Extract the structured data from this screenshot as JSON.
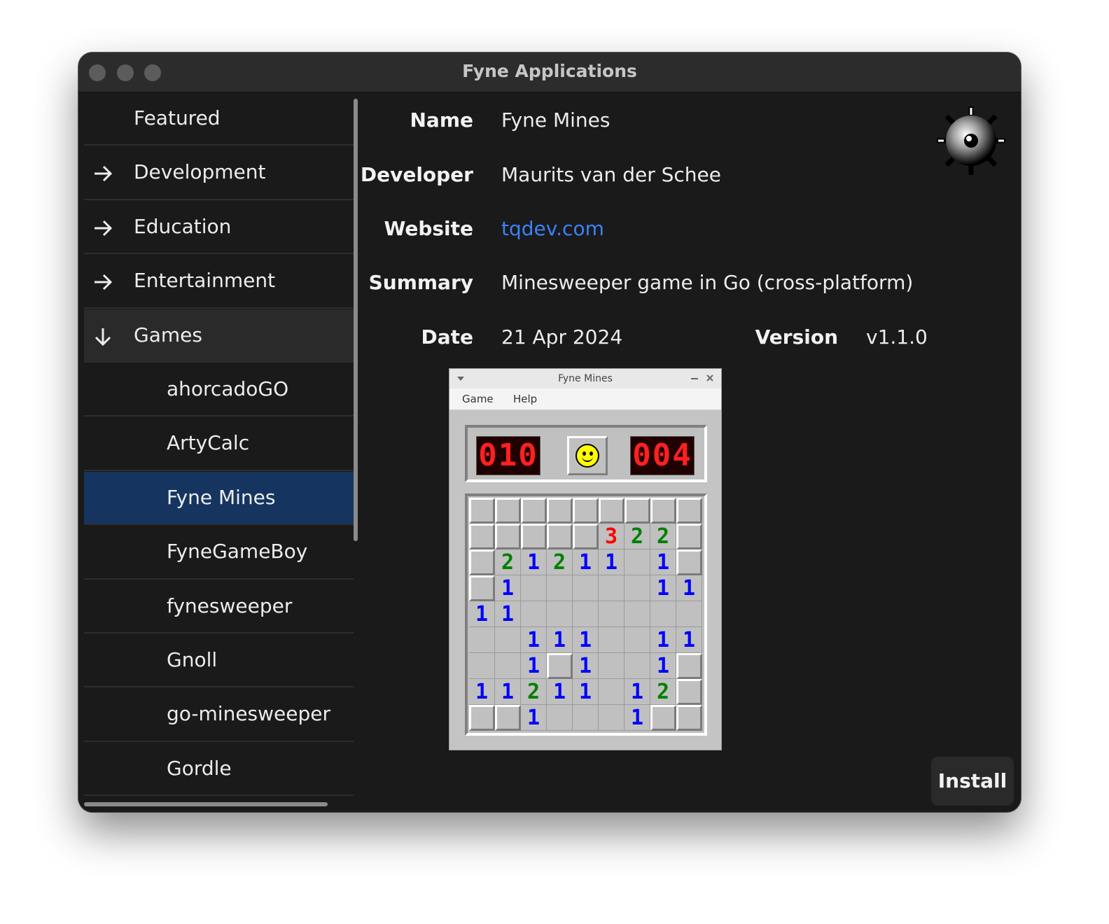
{
  "window": {
    "title": "Fyne Applications"
  },
  "sidebar": {
    "items": [
      {
        "label": "Featured",
        "arrow": "none",
        "indent": 0
      },
      {
        "label": "Development",
        "arrow": "right",
        "indent": 0
      },
      {
        "label": "Education",
        "arrow": "right",
        "indent": 0
      },
      {
        "label": "Entertainment",
        "arrow": "right",
        "indent": 0
      },
      {
        "label": "Games",
        "arrow": "down",
        "indent": 0
      },
      {
        "label": "ahorcadoGO",
        "arrow": "none",
        "indent": 1
      },
      {
        "label": "ArtyCalc",
        "arrow": "none",
        "indent": 1
      },
      {
        "label": "Fyne Mines",
        "arrow": "none",
        "indent": 1,
        "selected": true
      },
      {
        "label": "FyneGameBoy",
        "arrow": "none",
        "indent": 1
      },
      {
        "label": "fynesweeper",
        "arrow": "none",
        "indent": 1
      },
      {
        "label": "Gnoll",
        "arrow": "none",
        "indent": 1
      },
      {
        "label": "go-minesweeper",
        "arrow": "none",
        "indent": 1
      },
      {
        "label": "Gordle",
        "arrow": "none",
        "indent": 1
      }
    ]
  },
  "details": {
    "name_label": "Name",
    "name": "Fyne Mines",
    "developer_label": "Developer",
    "developer": "Maurits van der Schee",
    "website_label": "Website",
    "website": "tqdev.com",
    "summary_label": "Summary",
    "summary": "Minesweeper game in Go (cross-platform)",
    "date_label": "Date",
    "date": "21 Apr 2024",
    "version_label": "Version",
    "version": "v1.1.0",
    "icon": "mine-icon",
    "install_label": "Install"
  },
  "screenshot": {
    "title": "Fyne Mines",
    "menu": [
      "Game",
      "Help"
    ],
    "mines_counter": "010",
    "timer": "004",
    "face": "smiley-icon",
    "grid": [
      "#########",
      "#####322#",
      "#21211.1#",
      "#1.....11",
      "11.......",
      "..111..11",
      "..1#1..1#",
      "11211.12#",
      "##1...1##"
    ]
  },
  "colors": {
    "window_bg": "#1a1a1b",
    "titlebar": "#2c2c2c",
    "selected": "#153560",
    "link": "#3b82f6",
    "num1": "#0000ff",
    "num2": "#008000",
    "num3": "#ff0000"
  }
}
